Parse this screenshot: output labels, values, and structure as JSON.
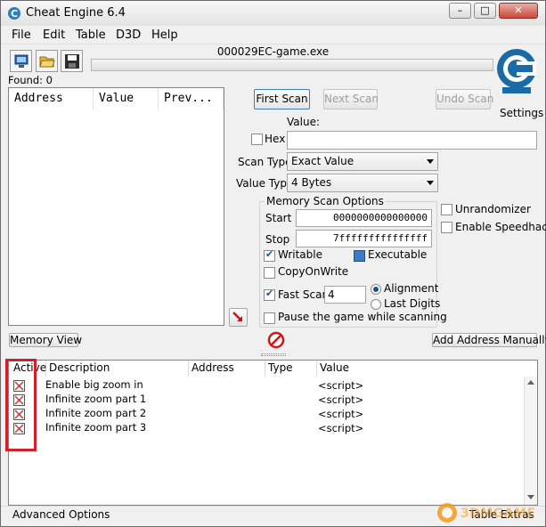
{
  "window": {
    "title": "Cheat Engine 6.4",
    "minimize_glyph": "–",
    "maximize_glyph": "□",
    "close_glyph": "✕"
  },
  "menu": [
    "File",
    "Edit",
    "Table",
    "D3D",
    "Help"
  ],
  "process_name": "000029EC-game.exe",
  "found_label": "Found: 0",
  "results_columns": [
    "Address",
    "Value",
    "Prev..."
  ],
  "scan": {
    "first_scan": "First Scan",
    "next_scan": "Next Scan",
    "undo_scan": "Undo Scan",
    "settings": "Settings",
    "value_label": "Value:",
    "hex_label": "Hex",
    "value_input": "",
    "scan_type_label": "Scan Type",
    "scan_type_value": "Exact Value",
    "value_type_label": "Value Type",
    "value_type_value": "4 Bytes"
  },
  "memory_options": {
    "title": "Memory Scan Options",
    "start_label": "Start",
    "start_value": "0000000000000000",
    "stop_label": "Stop",
    "stop_value": "7fffffffffffffff",
    "writable": "Writable",
    "executable": "Executable",
    "copy_on_write": "CopyOnWrite",
    "fast_scan": "Fast Scan",
    "fast_scan_value": "4",
    "alignment": "Alignment",
    "last_digits": "Last Digits",
    "pause_game": "Pause the game while scanning"
  },
  "right_options": {
    "unrandomizer": "Unrandomizer",
    "speedhack": "Enable Speedhack"
  },
  "buttons": {
    "memory_view": "Memory View",
    "add_address": "Add Address Manually"
  },
  "table": {
    "columns": [
      "Active",
      "Description",
      "Address",
      "Type",
      "Value"
    ],
    "rows": [
      {
        "description": "Enable big zoom in",
        "value": "<script>"
      },
      {
        "description": "Infinite zoom part 1",
        "value": "<script>"
      },
      {
        "description": "Infinite zoom part 2",
        "value": "<script>"
      },
      {
        "description": "Infinite zoom part 3",
        "value": "<script>"
      }
    ]
  },
  "footer": {
    "advanced_options": "Advanced Options",
    "table_extras": "Table Extras",
    "watermark": "3DMGAME"
  },
  "colors": {
    "highlight_box": "#d0202a",
    "logo_blue": "#1a6aa6"
  }
}
